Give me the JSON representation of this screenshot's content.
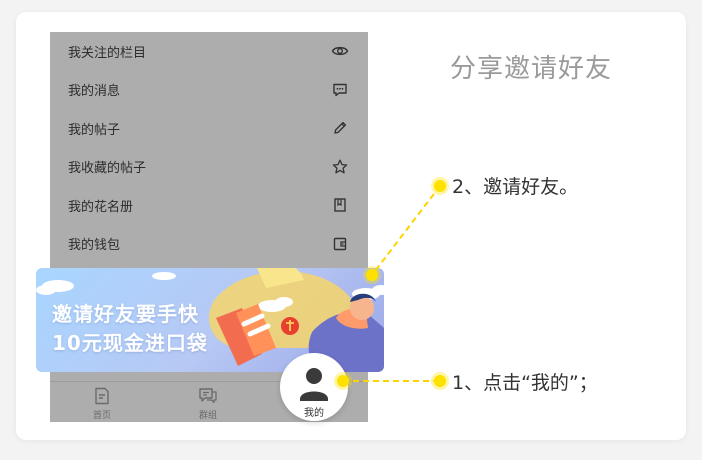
{
  "title": "分享邀请好友",
  "menu": [
    {
      "label": "我关注的栏目",
      "icon": "eye-icon"
    },
    {
      "label": "我的消息",
      "icon": "message-icon"
    },
    {
      "label": "我的帖子",
      "icon": "pencil-icon"
    },
    {
      "label": "我收藏的帖子",
      "icon": "star-icon"
    },
    {
      "label": "我的花名册",
      "icon": "book-icon"
    },
    {
      "label": "我的钱包",
      "icon": "wallet-icon"
    }
  ],
  "banner": {
    "line1": "邀请好友要手快",
    "line2": "10元现金进口袋"
  },
  "tabs": [
    {
      "label": "首页",
      "icon": "home-doc-icon"
    },
    {
      "label": "群组",
      "icon": "group-chat-icon"
    }
  ],
  "profile_button": {
    "label": "我的",
    "icon": "user-icon"
  },
  "steps": {
    "step1": "1、点击“我的”；",
    "step2": "2、邀请好友。"
  },
  "colors": {
    "highlight": "#ffe100",
    "overlay": "#adadad",
    "title": "#9a9a9a"
  }
}
